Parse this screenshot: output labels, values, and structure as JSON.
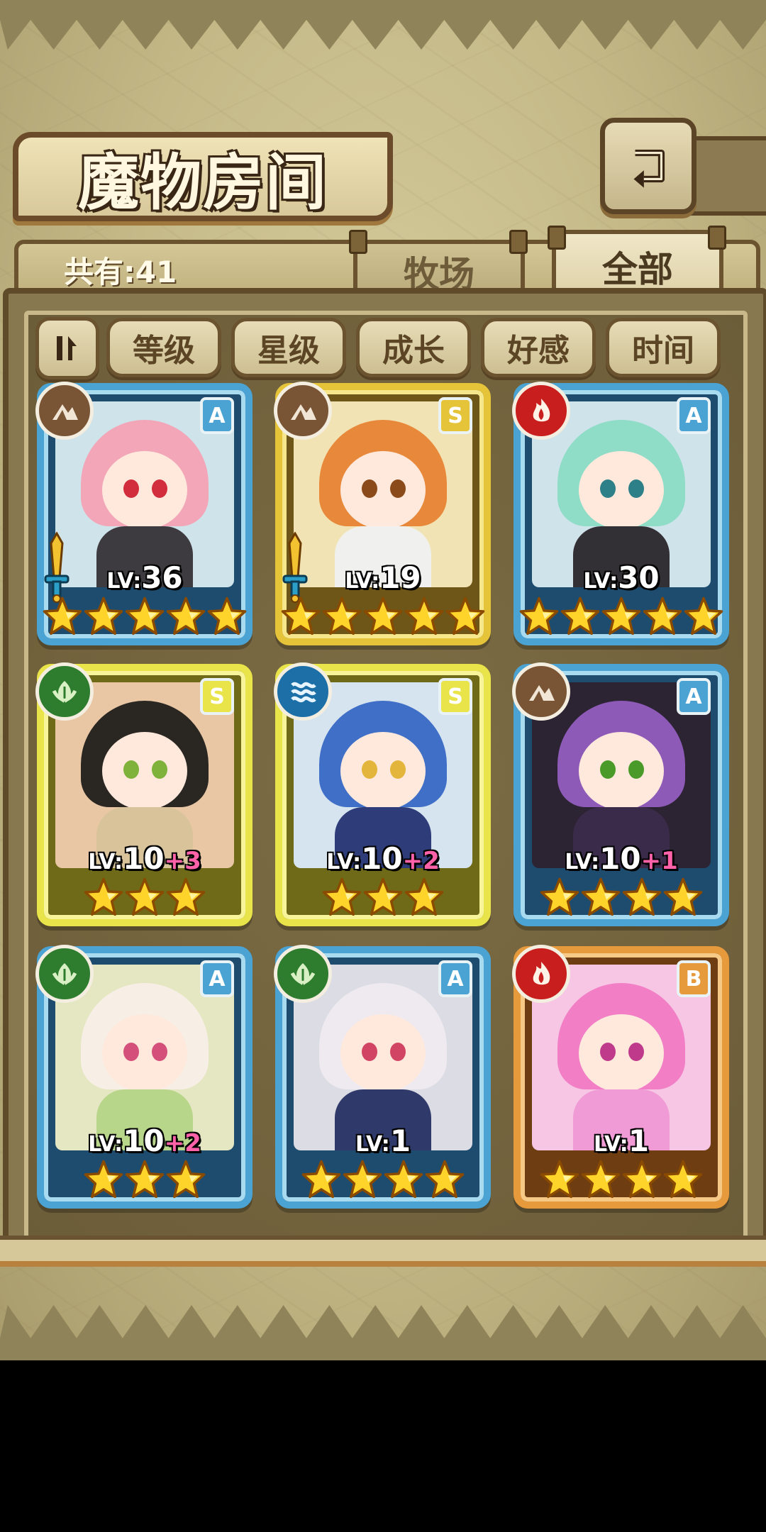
{
  "title": "魔物房间",
  "count_label": "共有:41",
  "tabs": [
    {
      "label": "牧场",
      "active": false
    },
    {
      "label": "全部",
      "active": true
    }
  ],
  "filters": [
    "等级",
    "星级",
    "成长",
    "好感",
    "时间"
  ],
  "icons": {
    "back": "back-arrow-icon",
    "sort": "sort-toggle-icon",
    "star": "star-icon",
    "sword": "sword-icon"
  },
  "colors": {
    "frame_blue": "#56a9d6",
    "frame_gold": "#e5c43a",
    "frame_yellow": "#e8e44a",
    "frame_orange": "#e79a3c",
    "elem_earth": "#7a5535",
    "elem_fire": "#c81e1e",
    "elem_water": "#1d6fa8",
    "elem_wood": "#2e7d2e",
    "plus_pink": "#ff62a8"
  },
  "cards": [
    {
      "rank": "A",
      "element": "earth",
      "lv_label": "LV:",
      "level": "36",
      "plus": "",
      "stars": 5,
      "sword": true,
      "frame": "blue",
      "hair": "#f3a6b8",
      "eye": "#d22d3c",
      "outfit": "#3d3b3f",
      "art": "#cfe3ea"
    },
    {
      "rank": "S",
      "element": "earth",
      "lv_label": "LV:",
      "level": "19",
      "plus": "",
      "stars": 5,
      "sword": true,
      "frame": "gold",
      "hair": "#e8883a",
      "eye": "#8b4a1a",
      "outfit": "#f0f0ee",
      "art": "#f2e3b4"
    },
    {
      "rank": "A",
      "element": "fire",
      "lv_label": "LV:",
      "level": "30",
      "plus": "",
      "stars": 5,
      "sword": false,
      "frame": "blue",
      "hair": "#8fdcc7",
      "eye": "#2d7f88",
      "outfit": "#333035",
      "art": "#cfe3ea"
    },
    {
      "rank": "S",
      "element": "wood",
      "lv_label": "LV:",
      "level": "10",
      "plus": "+3",
      "stars": 3,
      "sword": false,
      "frame": "yellow",
      "hair": "#2a2622",
      "eye": "#7fb23a",
      "outfit": "#d8c39a",
      "art": "#e9c7a4"
    },
    {
      "rank": "S",
      "element": "water",
      "lv_label": "LV:",
      "level": "10",
      "plus": "+2",
      "stars": 3,
      "sword": false,
      "frame": "yellow",
      "hair": "#3f6fc6",
      "eye": "#e3b53a",
      "outfit": "#2f3c7a",
      "art": "#d6e4f0"
    },
    {
      "rank": "A",
      "element": "earth",
      "lv_label": "LV:",
      "level": "10",
      "plus": "+1",
      "stars": 4,
      "sword": false,
      "frame": "blue",
      "hair": "#8e5ab8",
      "eye": "#4a9a2a",
      "outfit": "#3a2b4a",
      "art": "#2c2333"
    },
    {
      "rank": "A",
      "element": "wood",
      "lv_label": "LV:",
      "level": "10",
      "plus": "+2",
      "stars": 3,
      "sword": false,
      "frame": "blue",
      "hair": "#f7efe6",
      "eye": "#d4507a",
      "outfit": "#b8d68a",
      "art": "#e5e6c2"
    },
    {
      "rank": "A",
      "element": "wood",
      "lv_label": "LV:",
      "level": "1",
      "plus": "",
      "stars": 4,
      "sword": false,
      "frame": "blue",
      "hair": "#eeeaf0",
      "eye": "#d24463",
      "outfit": "#2f3a6a",
      "art": "#dcdce4"
    },
    {
      "rank": "B",
      "element": "fire",
      "lv_label": "LV:",
      "level": "1",
      "plus": "",
      "stars": 4,
      "sword": false,
      "frame": "orange",
      "hair": "#f27ec6",
      "eye": "#c03a8c",
      "outfit": "#f09ad6",
      "art": "#f6c6e4"
    }
  ]
}
